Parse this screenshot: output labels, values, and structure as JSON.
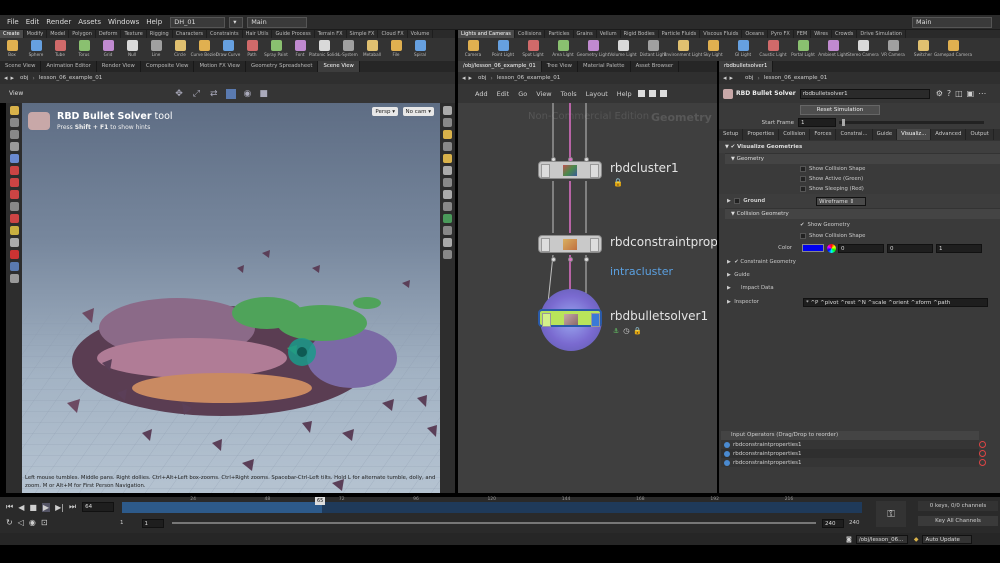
{
  "menubar": {
    "items": [
      "File",
      "Edit",
      "Render",
      "Assets",
      "Windows",
      "Help"
    ],
    "desktop": "DH_01",
    "workspace": "Main",
    "right_workspace": "Main"
  },
  "shelf_left": {
    "tabs": [
      "Create",
      "Modify",
      "Model",
      "Polygon",
      "Deform",
      "Texture",
      "Rigging",
      "Characters",
      "Constraints",
      "Hair Utils",
      "Guide Process",
      "Terrain FX",
      "Simple FX",
      "Cloud FX",
      "Volume"
    ],
    "tools": [
      "Box",
      "Sphere",
      "Tube",
      "Torus",
      "Grid",
      "Null",
      "Line",
      "Circle",
      "Curve Bezier",
      "Draw Curve",
      "Path",
      "Spray Paint",
      "Font",
      "Platonic Solids",
      "L-System",
      "Metaball",
      "File",
      "Spiral"
    ]
  },
  "shelf_right": {
    "tabs": [
      "Lights and Cameras",
      "Collisions",
      "Particles",
      "Grains",
      "Vellum",
      "Rigid Bodies",
      "Particle Fluids",
      "Viscous Fluids",
      "Oceans",
      "Pyro FX",
      "FEM",
      "Wires",
      "Crowds",
      "Drive Simulation"
    ],
    "tools": [
      "Camera",
      "Point Light",
      "Spot Light",
      "Area Light",
      "Geometry Light",
      "Volume Light",
      "Distant Light",
      "Environment Light",
      "Sky Light",
      "GI Light",
      "Caustic Light",
      "Portal Light",
      "Ambient Light",
      "Stereo Camera",
      "VR Camera",
      "Switcher",
      "Gamepad Camera"
    ]
  },
  "left_pane": {
    "tabs": [
      "Scene View",
      "Animation Editor",
      "Render View",
      "Composite View",
      "Motion FX View",
      "Geometry Spreadsheet",
      "Scene View"
    ],
    "path": [
      "obj",
      "lesson_06_example_01"
    ],
    "view_label": "View",
    "tool_title_bold": "RBD Bullet Solver",
    "tool_title_rest": " tool",
    "hint_prefix": "Press ",
    "hint_keys": "Shift + F1",
    "hint_suffix": " to show hints",
    "persp": "Persp",
    "cam": "No cam",
    "status_text": "Left mouse tumbles. Middle pans. Right dollies. Ctrl+Alt+Left box-zooms. Ctrl+Right zooms. Spacebar-Ctrl-Left tilts. Hold L for alternate tumble, dolly, and zoom. M or Alt+M for First Person Navigation."
  },
  "network": {
    "tabs": [
      "/obj/lesson_06_example_01",
      "Tree View",
      "Material Palette",
      "Asset Browser"
    ],
    "path": [
      "obj",
      "lesson_06_example_01"
    ],
    "menu": [
      "Add",
      "Edit",
      "Go",
      "View",
      "Tools",
      "Layout",
      "Help"
    ],
    "watermark_left": "Non-Commercial Edition",
    "watermark_right": "Geometry",
    "nodes": [
      {
        "name": "rbdcluster1"
      },
      {
        "name": "rbdconstraintprop"
      },
      {
        "name": "rbdbulletsolver1"
      }
    ],
    "sublabel": "intracluster"
  },
  "params": {
    "tab": "rbdbulletsolver1",
    "path": [
      "obj",
      "lesson_06_example_01"
    ],
    "node_type": "RBD Bullet Solver",
    "node_name": "rbdbulletsolver1",
    "reset_label": "Reset Simulation",
    "start_frame_label": "Start Frame",
    "start_frame_value": "1",
    "start_frame_slider": 0.02,
    "tabs": [
      "Setup",
      "Properties",
      "Collision",
      "Forces",
      "Constrai...",
      "Guide",
      "Visualiz...",
      "Advanced",
      "Output"
    ],
    "visualize_label": "Visualize Geometries",
    "geometry_label": "Geometry",
    "geo_opts": [
      "Show Collision Shape",
      "Show Active (Green)",
      "Show Sleeping (Red)"
    ],
    "ground_label": "Ground",
    "ground_value": "Wireframe",
    "collision_geo_label": "Collision Geometry",
    "collision_opts": [
      "Show Geometry",
      "Show Collision Shape"
    ],
    "color_label": "Color",
    "color_value": "#0000ee",
    "color_values": [
      "0",
      "0",
      "1"
    ],
    "constraint_geo_label": "Constraint Geometry",
    "guide_label": "Guide",
    "impact_label": "Impact Data",
    "inspector_label": "Inspector",
    "inspector_value": "* ^P ^pivot ^rest ^N ^scale ^orient ^xform ^path",
    "input_ops_label": "Input Operators (Drag/Drop to reorder)",
    "input_ops": [
      "rbdconstraintproperties1",
      "rbdconstraintproperties1",
      "rbdconstraintproperties1"
    ]
  },
  "timeline": {
    "frame": "64",
    "marker": "65",
    "ticks": [
      "24",
      "48",
      "72",
      "96",
      "120",
      "144",
      "168",
      "192",
      "216"
    ],
    "start": "1",
    "range_start": "1",
    "range_end": "240",
    "end": "240",
    "end2": "240",
    "keys_info": "0 keys, 0/0 channels",
    "key_channels": "Key All Channels",
    "progress": 0.27
  },
  "bottom": {
    "path": "/obj/lesson_06...",
    "update_mode": "Auto Update"
  }
}
